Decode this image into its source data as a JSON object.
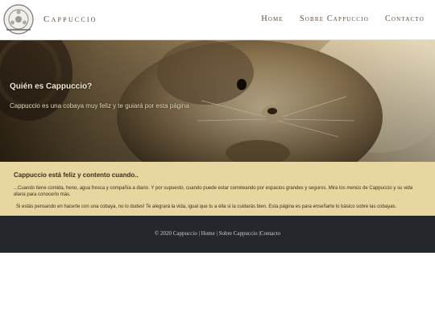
{
  "header": {
    "brand": "Cappuccio",
    "logo_icon": "camera-reel-icon",
    "nav": [
      "Home",
      "Sobre Cappuccio",
      "Contacto"
    ]
  },
  "hero": {
    "title": "Quién es Cappuccio?",
    "subtitle": "Cappuccio es una cobaya muy feliz y te guiará por esta página",
    "image_subject": "guinea-pig-photo"
  },
  "info": {
    "title": "Cappuccio está feliz y contento cuando..",
    "p1_a": "...Cuando tiene comida, heno, agua fresca y compañía a diario. Y por supuesto, cuando puede estar correteando por espacios grandes y seguros. Mira los ",
    "p1_menus": "menús",
    "p1_b": " de Cappuccio y su ",
    "p1_vida": "vida diaria",
    "p1_c": " para conocerlo más.",
    "p2": "Si estás pensando en hacerte con una cobaya, no lo dudes! Te alegrará la vida, igual que tu a ella si la cuidarás bien. Esta página es para enseñarte lo básico sobre las cobayas."
  },
  "footer": {
    "copyright": "© 2020 Cappuccio |",
    "home": "Home",
    "sep1": "|",
    "about": "Sobre Cappuccio",
    "sep2": "|",
    "contact": "Contacto"
  },
  "colors": {
    "info_bg": "#e8d6a0",
    "footer_bg": "#24272b",
    "brand_text": "#5b4a3a"
  }
}
